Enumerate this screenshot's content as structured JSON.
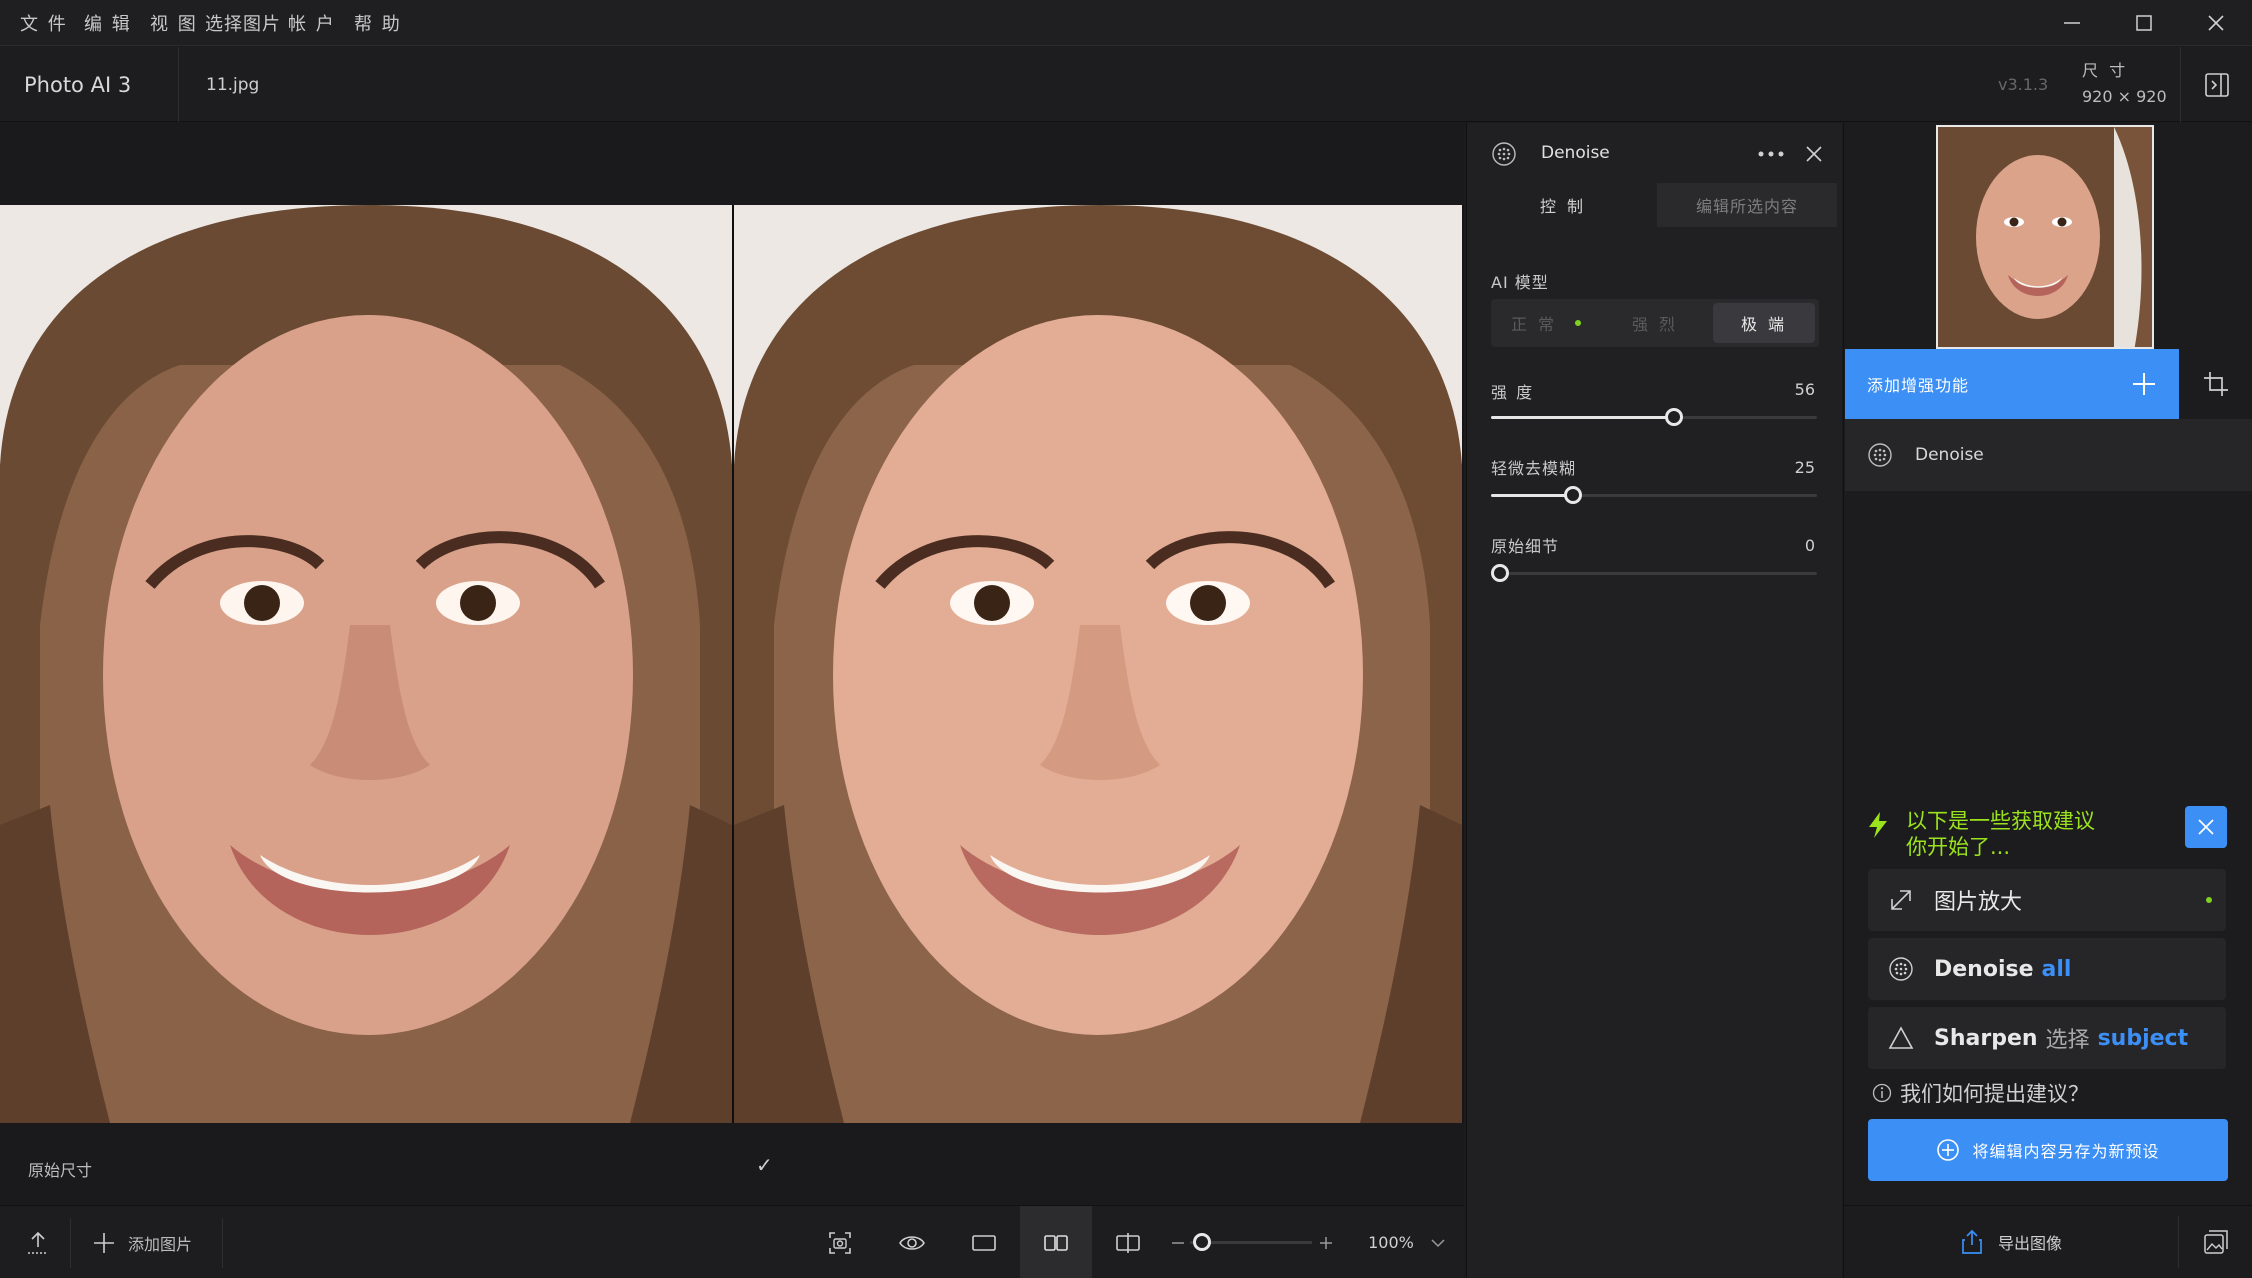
{
  "menu": [
    "文 件",
    "编 辑",
    "视 图",
    "选择图片",
    "帐 户",
    "帮 助"
  ],
  "title": {
    "app_name": "Photo AI 3",
    "file_name": "11.jpg",
    "version": "v3.1.3",
    "size_label": "尺 寸",
    "size_value": "920 × 920"
  },
  "canvas": {
    "left_caption": "原始尺寸",
    "right_caption": "✓"
  },
  "toolbar": {
    "add_image_label": "添加图片",
    "zoom_value": "100%",
    "zoom_level": 0.1
  },
  "panel": {
    "title": "Denoise",
    "tabs": [
      "控 制",
      "编辑所选内容"
    ],
    "ai_model_label": "AI 模型",
    "models": [
      "正 常",
      "强 烈",
      "极 端"
    ],
    "selected_model": "极 端",
    "sliders": [
      {
        "label": "强 度",
        "value": "56",
        "fraction": 0.56
      },
      {
        "label": "轻微去模糊",
        "value": "25",
        "fraction": 0.25
      },
      {
        "label": "原始细节",
        "value": "0",
        "fraction": 0.0
      }
    ]
  },
  "sidebar": {
    "add_enhancement_label": "添加增强功能",
    "enhancements": [
      {
        "name": "Denoise"
      }
    ],
    "tip_line1": "以下是一些获取建议",
    "tip_line2": "你开始了...",
    "suggestions": {
      "upscale": "图片放大",
      "denoise_main": "Denoise",
      "denoise_scope": "all",
      "sharpen_main": "Sharpen",
      "sharpen_mid": "选择",
      "sharpen_scope": "subject"
    },
    "how_label": "我们如何提出建议？",
    "save_preset_label": "将编辑内容另存为新预设",
    "export_label": "导出图像"
  },
  "colors": {
    "accent_blue": "#3b8ff5",
    "tip_green": "#9be31c",
    "dark_bg": "#1b1b1d"
  },
  "icons": [
    "upload-icon",
    "plus-icon",
    "screenshot-icon",
    "eye-icon",
    "single-view-icon",
    "side-by-side-icon",
    "split-view-icon",
    "zoom-out-icon",
    "zoom-in-icon",
    "chevron-down-icon",
    "denoise-icon",
    "more-icon",
    "close-icon",
    "crop-icon",
    "lightning-icon",
    "expand-icon",
    "sharpen-icon",
    "info-icon",
    "export-icon",
    "gallery-icon",
    "panel-toggle-icon"
  ]
}
